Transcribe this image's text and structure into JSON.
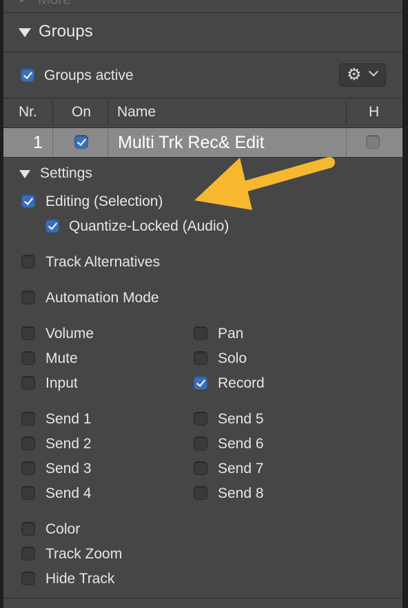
{
  "more": {
    "label": "More"
  },
  "groups": {
    "title": "Groups",
    "active_label": "Groups active",
    "active_checked": true,
    "gear_icon": "gear-icon"
  },
  "table": {
    "columns": [
      "Nr.",
      "On",
      "Name",
      "H"
    ],
    "rows": [
      {
        "nr": "1",
        "on": true,
        "name": "Multi Trk Rec& Edit",
        "hide": false
      }
    ]
  },
  "settings": {
    "title": "Settings",
    "editing": {
      "label": "Editing (Selection)",
      "checked": true
    },
    "quantize": {
      "label": "Quantize-Locked (Audio)",
      "checked": true
    },
    "track_alternatives": {
      "label": "Track Alternatives",
      "checked": false
    },
    "automation_mode": {
      "label": "Automation Mode",
      "checked": false
    },
    "volume": {
      "label": "Volume",
      "checked": false
    },
    "pan": {
      "label": "Pan",
      "checked": false
    },
    "mute": {
      "label": "Mute",
      "checked": false
    },
    "solo": {
      "label": "Solo",
      "checked": false
    },
    "input": {
      "label": "Input",
      "checked": false
    },
    "record": {
      "label": "Record",
      "checked": true
    },
    "send1": {
      "label": "Send 1",
      "checked": false
    },
    "send2": {
      "label": "Send 2",
      "checked": false
    },
    "send3": {
      "label": "Send 3",
      "checked": false
    },
    "send4": {
      "label": "Send 4",
      "checked": false
    },
    "send5": {
      "label": "Send 5",
      "checked": false
    },
    "send6": {
      "label": "Send 6",
      "checked": false
    },
    "send7": {
      "label": "Send 7",
      "checked": false
    },
    "send8": {
      "label": "Send 8",
      "checked": false
    },
    "color": {
      "label": "Color",
      "checked": false
    },
    "track_zoom": {
      "label": "Track Zoom",
      "checked": false
    },
    "hide_track": {
      "label": "Hide Track",
      "checked": false
    }
  },
  "colors": {
    "panel_bg": "#464646",
    "selected_row_bg": "#8a8a8a",
    "checkbox_on": "#3c6fb8",
    "annotation_arrow": "#f5b82e"
  }
}
